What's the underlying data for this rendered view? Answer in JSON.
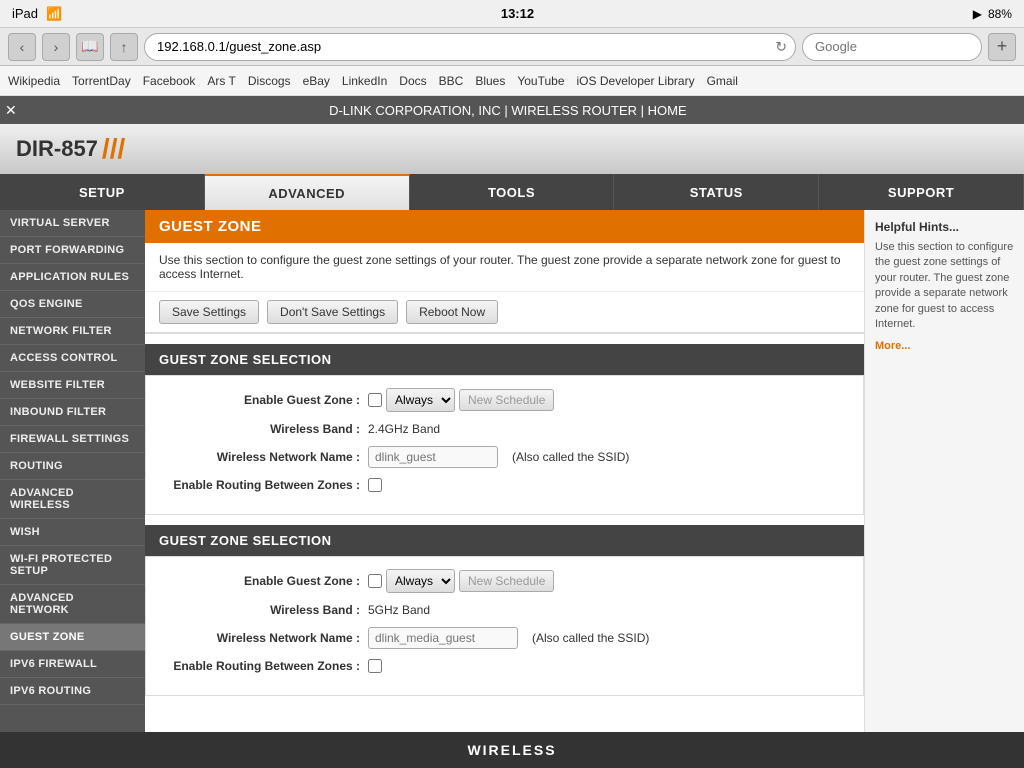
{
  "status_bar": {
    "left_icon": "iPad",
    "wifi_icon": "wifi",
    "time": "13:12",
    "signal_icon": "signal",
    "battery": "88%"
  },
  "browser": {
    "back_label": "‹",
    "forward_label": "›",
    "bookmark_icon": "📖",
    "share_icon": "↑",
    "url": "192.168.0.1/guest_zone.asp",
    "refresh_icon": "↻",
    "search_placeholder": "Google",
    "new_tab": "+"
  },
  "bookmarks": [
    "Wikipedia",
    "TorrentDay",
    "Facebook",
    "Ars T",
    "Discogs",
    "eBay",
    "LinkedIn",
    "Docs",
    "BBC",
    "Blues",
    "YouTube",
    "iOS Developer Library",
    "Gmail"
  ],
  "page_title_bar": {
    "close": "✕",
    "title": "D-LINK CORPORATION, INC | WIRELESS ROUTER | HOME"
  },
  "router": {
    "logo": "DIR-857",
    "logo_slashes": "///",
    "nav_tabs": [
      "SETUP",
      "ADVANCED",
      "TOOLS",
      "STATUS",
      "SUPPORT"
    ],
    "active_tab": "ADVANCED"
  },
  "sidebar": {
    "items": [
      "VIRTUAL SERVER",
      "PORT FORWARDING",
      "APPLICATION RULES",
      "QOS ENGINE",
      "NETWORK FILTER",
      "ACCESS CONTROL",
      "WEBSITE FILTER",
      "INBOUND FILTER",
      "FIREWALL SETTINGS",
      "ROUTING",
      "ADVANCED WIRELESS",
      "WISH",
      "WI-FI PROTECTED SETUP",
      "ADVANCED NETWORK",
      "GUEST ZONE",
      "IPV6 FIREWALL",
      "IPV6 ROUTING"
    ],
    "active": "GUEST ZONE"
  },
  "content": {
    "page_heading": "GUEST ZONE",
    "description": "Use this section to configure the guest zone settings of your router. The guest zone provide a separate network zone for guest to access Internet.",
    "buttons": {
      "save": "Save Settings",
      "dont_save": "Don't Save Settings",
      "reboot": "Reboot Now"
    },
    "section1": {
      "title": "GUEST ZONE SELECTION",
      "enable_label": "Enable Guest Zone :",
      "schedule_label": "Always",
      "new_schedule": "New Schedule",
      "band_label": "Wireless Band :",
      "band_value": "2.4GHz Band",
      "network_name_label": "Wireless Network Name :",
      "network_name_placeholder": "dlink_guest",
      "ssid_note": "(Also called the SSID)",
      "routing_label": "Enable Routing Between Zones :"
    },
    "section2": {
      "title": "GUEST ZONE SELECTION",
      "enable_label": "Enable Guest Zone :",
      "schedule_label": "Always",
      "new_schedule": "New Schedule",
      "band_label": "Wireless Band :",
      "band_value": "5GHz Band",
      "network_name_label": "Wireless Network Name :",
      "network_name_placeholder": "dlink_media_guest",
      "ssid_note": "(Also called the SSID)",
      "routing_label": "Enable Routing Between Zones :"
    }
  },
  "hints": {
    "title": "Helpful Hints...",
    "text": "Use this section to configure the guest zone settings of your router. The guest zone provide a separate network zone for guest to access Internet.",
    "more": "More..."
  },
  "footer": {
    "brand": "WIRELESS"
  }
}
